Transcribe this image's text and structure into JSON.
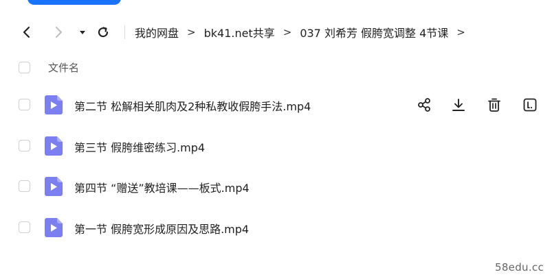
{
  "breadcrumb": {
    "items": [
      "我的网盘",
      "bk41.net共享",
      "037 刘希芳 假胯宽调整 4节课"
    ],
    "separator": ">",
    "trailing": ">"
  },
  "list_header": {
    "name_label": "文件名"
  },
  "files": [
    {
      "name": "第二节 松解相关肌肉及2种私教收假胯手法.mp4",
      "icon": "video-file-icon",
      "hovered": true
    },
    {
      "name": "第三节 假胯维密练习.mp4",
      "icon": "video-file-icon"
    },
    {
      "name": "第四节 “赠送”教培课——板式.mp4",
      "icon": "video-file-icon"
    },
    {
      "name": "第一节 假胯宽形成原因及思路.mp4",
      "icon": "video-file-icon"
    }
  ],
  "row_actions": [
    "share-icon",
    "download-icon",
    "delete-icon",
    "more-info-icon"
  ],
  "watermark": "58edu.cc",
  "colors": {
    "accent": "#1a73ff",
    "file_icon": "#7b7ff0",
    "checkbox_border": "#cfcfcf"
  }
}
